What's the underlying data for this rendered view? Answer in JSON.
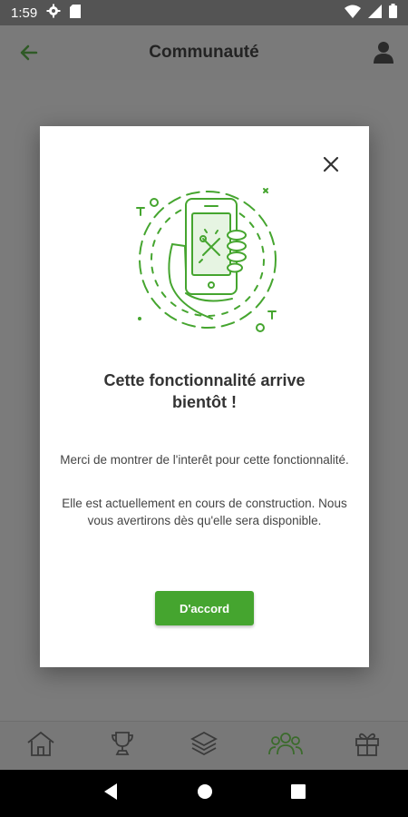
{
  "status_bar": {
    "time": "1:59",
    "icons": [
      "settings-icon",
      "sd-card-icon",
      "wifi-icon",
      "signal-icon",
      "battery-icon"
    ]
  },
  "app_bar": {
    "title": "Communauté",
    "back_icon": "arrow-left-icon",
    "profile_icon": "person-icon"
  },
  "dialog": {
    "heading_line1": "Cette fonctionnalité arrive",
    "heading_line2": "bientôt !",
    "paragraph1": "Merci de montrer de l'interêt pour cette fonctionnalité.",
    "paragraph2": "Elle est actuellement en cours de construction. Nous vous avertirons dès qu'elle sera disponible.",
    "ok_label": "D'accord",
    "close_icon": "close-icon",
    "illustration": "phone-under-construction-icon"
  },
  "bottom_nav": {
    "items": [
      {
        "icon": "home-icon",
        "active": false
      },
      {
        "icon": "trophy-icon",
        "active": false
      },
      {
        "icon": "layers-icon",
        "active": false
      },
      {
        "icon": "community-icon",
        "active": true
      },
      {
        "icon": "gift-icon",
        "active": false
      }
    ]
  },
  "colors": {
    "accent": "#45a52f",
    "accent_dimmed": "#3b6b2c",
    "scrim": "#7b7b7b",
    "status_bar": "#545454"
  }
}
